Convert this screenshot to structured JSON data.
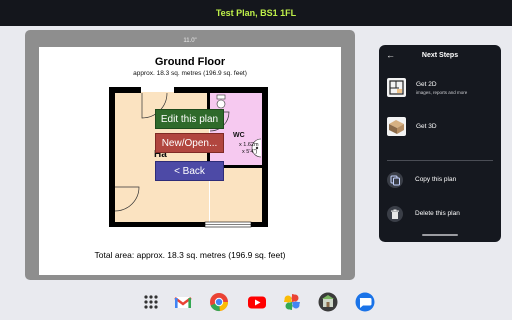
{
  "titlebar": {
    "title": "Test Plan, BS1 1FL"
  },
  "canvas": {
    "dimension_label": "11.0\"",
    "plan_title": "Ground Floor",
    "plan_subtitle": "approx. 18.3 sq. metres (196.9 sq. feet)",
    "total_area": "Total area: approx. 18.3 sq. metres (196.9 sq. feet)",
    "rooms": {
      "hall_label": "Ha",
      "wc_label": "WC",
      "wc_dims_1": "x 1.62m",
      "wc_dims_2": "x 5'4\")"
    }
  },
  "overlay_buttons": {
    "edit": "Edit this plan",
    "new_open": "New/Open...",
    "back": "< Back"
  },
  "next_steps": {
    "back_icon": "back-arrow-icon",
    "title": "Next Steps",
    "options": [
      {
        "title": "Get 2D",
        "subtitle": "images, reports and more"
      },
      {
        "title": "Get 3D",
        "subtitle": ""
      }
    ],
    "actions": [
      {
        "label": "Copy this plan",
        "icon": "copy-icon"
      },
      {
        "label": "Delete this plan",
        "icon": "trash-icon"
      }
    ]
  },
  "dock": {
    "apps": [
      "app-grid-icon",
      "gmail-icon",
      "chrome-icon",
      "youtube-icon",
      "photos-icon",
      "planner-app-icon",
      "messages-icon"
    ]
  },
  "colors": {
    "title_accent": "#bff04a",
    "hall_fill": "#fbe3c1",
    "wc_fill": "#f6c9f0",
    "edit_button": "#2f6a2b",
    "new_button": "#b1463f",
    "back_button": "#4d4aa6"
  }
}
